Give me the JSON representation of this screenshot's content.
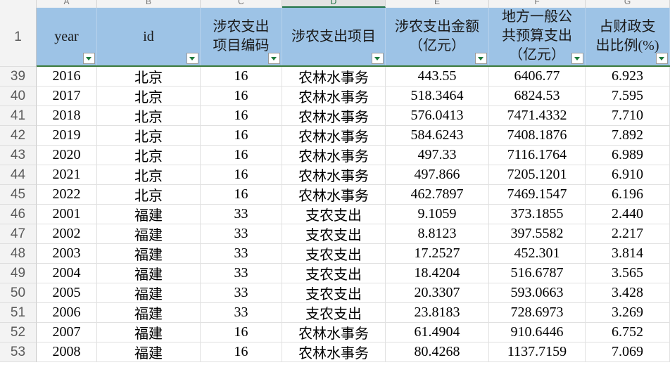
{
  "column_letters": [
    "A",
    "B",
    "C",
    "D",
    "E",
    "F",
    "G"
  ],
  "selected_column": "D",
  "header_row_number": "1",
  "headers": [
    {
      "lines": [
        "year"
      ]
    },
    {
      "lines": [
        "id"
      ]
    },
    {
      "lines": [
        "涉农支出",
        "项目编码"
      ]
    },
    {
      "lines": [
        "涉农支出项目"
      ]
    },
    {
      "lines": [
        "涉农支出金额",
        "（亿元）"
      ]
    },
    {
      "lines": [
        "地方一般公",
        "共预算支出",
        "（亿元）"
      ]
    },
    {
      "lines": [
        "占财政支",
        "出比例(%)"
      ]
    }
  ],
  "rows": [
    {
      "row": "39",
      "cells": [
        "2016",
        "北京",
        "16",
        "农林水事务",
        "443.55",
        "6406.77",
        "6.923"
      ]
    },
    {
      "row": "40",
      "cells": [
        "2017",
        "北京",
        "16",
        "农林水事务",
        "518.3464",
        "6824.53",
        "7.595"
      ]
    },
    {
      "row": "41",
      "cells": [
        "2018",
        "北京",
        "16",
        "农林水事务",
        "576.0413",
        "7471.4332",
        "7.710"
      ]
    },
    {
      "row": "42",
      "cells": [
        "2019",
        "北京",
        "16",
        "农林水事务",
        "584.6243",
        "7408.1876",
        "7.892"
      ]
    },
    {
      "row": "43",
      "cells": [
        "2020",
        "北京",
        "16",
        "农林水事务",
        "497.33",
        "7116.1764",
        "6.989"
      ]
    },
    {
      "row": "44",
      "cells": [
        "2021",
        "北京",
        "16",
        "农林水事务",
        "497.866",
        "7205.1201",
        "6.910"
      ]
    },
    {
      "row": "45",
      "cells": [
        "2022",
        "北京",
        "16",
        "农林水事务",
        "462.7897",
        "7469.1547",
        "6.196"
      ]
    },
    {
      "row": "46",
      "cells": [
        "2001",
        "福建",
        "33",
        "支农支出",
        "9.1059",
        "373.1855",
        "2.440"
      ]
    },
    {
      "row": "47",
      "cells": [
        "2002",
        "福建",
        "33",
        "支农支出",
        "8.8123",
        "397.5582",
        "2.217"
      ]
    },
    {
      "row": "48",
      "cells": [
        "2003",
        "福建",
        "33",
        "支农支出",
        "17.2527",
        "452.301",
        "3.814"
      ]
    },
    {
      "row": "49",
      "cells": [
        "2004",
        "福建",
        "33",
        "支农支出",
        "18.4204",
        "516.6787",
        "3.565"
      ]
    },
    {
      "row": "50",
      "cells": [
        "2005",
        "福建",
        "33",
        "支农支出",
        "20.3307",
        "593.0663",
        "3.428"
      ]
    },
    {
      "row": "51",
      "cells": [
        "2006",
        "福建",
        "33",
        "支农支出",
        "23.8183",
        "728.6973",
        "3.269"
      ]
    },
    {
      "row": "52",
      "cells": [
        "2007",
        "福建",
        "16",
        "农林水事务",
        "61.4904",
        "910.6446",
        "6.752"
      ]
    },
    {
      "row": "53",
      "cells": [
        "2008",
        "福建",
        "16",
        "农林水事务",
        "80.4268",
        "1137.7159",
        "7.069"
      ]
    }
  ],
  "colors": {
    "header_fill": "#9dc3e6",
    "filter_arrow": "#1e7a3c",
    "selected_column": "#217346"
  },
  "icons": {
    "filter": "filter-dropdown-icon"
  }
}
